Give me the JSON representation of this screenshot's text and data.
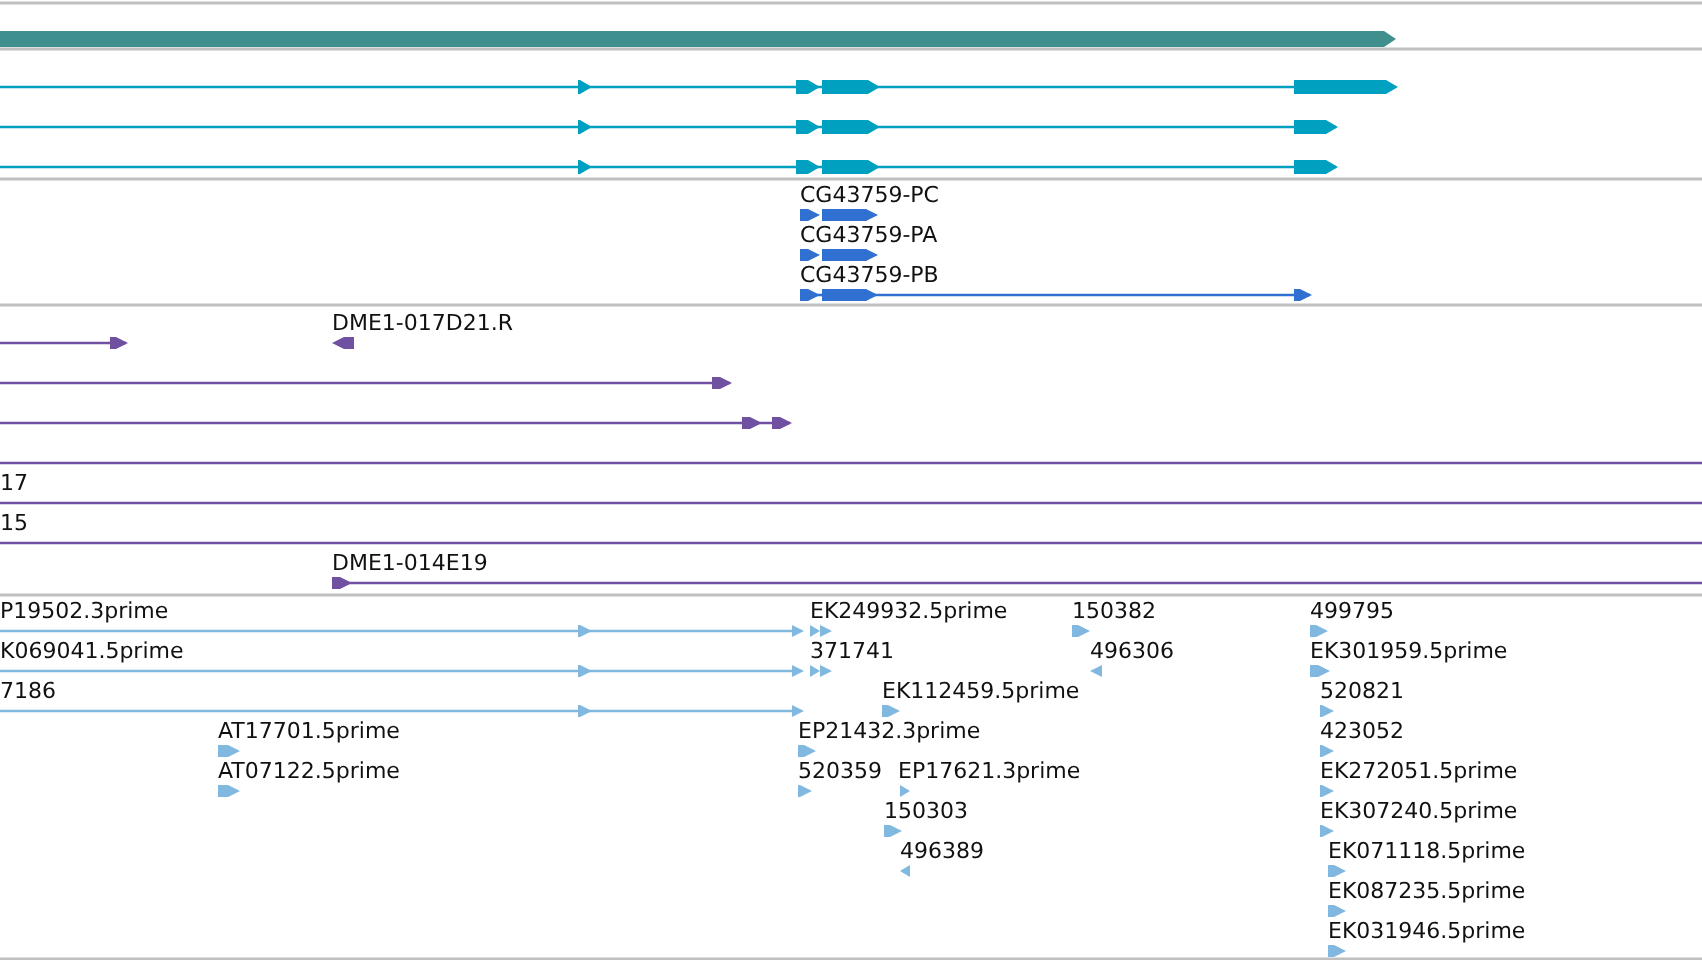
{
  "tracks": [
    {
      "kind": "gene",
      "features": [
        {
          "reverse": false
        }
      ]
    },
    {
      "kind": "transcript",
      "features": [
        {
          "reverse": false
        },
        {
          "reverse": false
        },
        {
          "reverse": false
        }
      ]
    },
    {
      "kind": "cds",
      "features": [
        {
          "label": "CG43759-PC",
          "reverse": false
        },
        {
          "label": "CG43759-PA",
          "reverse": false
        },
        {
          "label": "CG43759-PB",
          "reverse": false
        }
      ]
    },
    {
      "kind": "clone",
      "features": [
        {
          "reverse": false
        },
        {
          "label": "DME1-017D21.R",
          "reverse": true
        },
        {
          "reverse": false
        },
        {
          "reverse": false
        },
        {
          "label": "17"
        },
        {
          "label": "15"
        },
        {
          "label": "DME1-014E19",
          "reverse": false
        }
      ]
    },
    {
      "kind": "est",
      "features": [
        {
          "label": "P19502.3prime",
          "reverse": false
        },
        {
          "label": "EK249932.5prime",
          "reverse": false
        },
        {
          "label": "150382",
          "reverse": false
        },
        {
          "label": "499795",
          "reverse": false
        },
        {
          "label": "K069041.5prime",
          "reverse": false
        },
        {
          "label": "371741",
          "reverse": false
        },
        {
          "label": "496306",
          "reverse": true
        },
        {
          "label": "EK301959.5prime",
          "reverse": false
        },
        {
          "label": "7186",
          "reverse": false
        },
        {
          "label": "EK112459.5prime",
          "reverse": false
        },
        {
          "label": "520821",
          "reverse": false
        },
        {
          "label": "AT17701.5prime",
          "reverse": false
        },
        {
          "label": "EP21432.3prime",
          "reverse": false
        },
        {
          "label": "423052",
          "reverse": false
        },
        {
          "label": "AT07122.5prime",
          "reverse": false
        },
        {
          "label": "520359",
          "reverse": false
        },
        {
          "label": "EP17621.3prime",
          "reverse": false
        },
        {
          "label": "EK272051.5prime",
          "reverse": false
        },
        {
          "label": "150303",
          "reverse": false
        },
        {
          "label": "EK307240.5prime",
          "reverse": false
        },
        {
          "label": "496389",
          "reverse": true
        },
        {
          "label": "EK071118.5prime",
          "reverse": false
        },
        {
          "label": "EK087235.5prime",
          "reverse": false
        },
        {
          "label": "EK031946.5prime",
          "reverse": false
        }
      ]
    }
  ]
}
